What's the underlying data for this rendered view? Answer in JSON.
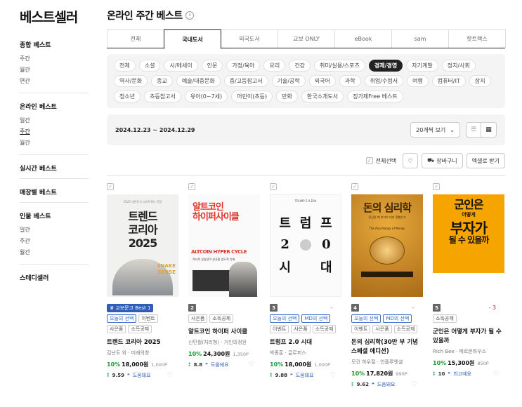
{
  "sidebar": {
    "title": "베스트셀러",
    "groups": [
      {
        "head": "종합 베스트",
        "items": [
          "주간",
          "월간",
          "연간"
        ]
      },
      {
        "head": "온라인 베스트",
        "items": [
          "일간",
          "주간",
          "월간"
        ]
      },
      {
        "head": "실시간 베스트",
        "items": []
      },
      {
        "head": "매장별 베스트",
        "items": []
      },
      {
        "head": "인물 베스트",
        "items": [
          "일간",
          "주간",
          "월간"
        ]
      },
      {
        "head": "스테디셀러",
        "items": []
      }
    ]
  },
  "main": {
    "title": "온라인 주간 베스트",
    "info": "!",
    "tabs": [
      "전체",
      "국내도서",
      "외국도서",
      "교보 ONLY",
      "eBook",
      "sam",
      "핫트랙스"
    ],
    "active_tab": "국내도서",
    "categories": [
      "전체",
      "소설",
      "시/에세이",
      "인문",
      "가정/육아",
      "요리",
      "건강",
      "취미/실용/스포츠",
      "경제/경영",
      "자기계발",
      "정치/사회",
      "역사/문화",
      "종교",
      "예술/대중문화",
      "중/고등참고서",
      "기술/공학",
      "외국어",
      "과학",
      "취업/수험서",
      "여행",
      "컴퓨터/IT",
      "잡지",
      "청소년",
      "초등참고서",
      "유아(0~7세)",
      "어린이(초등)",
      "만화",
      "한국소개도서",
      "징가제Free 베스트"
    ],
    "active_category": "경제/경영",
    "date_range": "2024.12.23 ~ 2024.12.29",
    "view_select": "20개씩 보기",
    "select_all": "전체선택",
    "cart": "장바구니",
    "excel": "엑셀로 받기"
  },
  "products": [
    {
      "rank": "",
      "badge": "교보문고 Best 1",
      "tags": [
        "오늘의 선택",
        "이벤트",
        "사은품",
        "소득공제"
      ],
      "tag_blue": [
        true,
        false,
        false,
        false
      ],
      "title": "트렌드 코리아 2025",
      "meta": "김난도 외 · 미래의창",
      "discount": "10%",
      "price": "18,000원",
      "points": "1,000P",
      "score": "9.59",
      "review": "도움돼요",
      "change": "",
      "cover": {
        "a": "2025 대한민국 소비트렌드 전망",
        "b": "트렌드\n코리아\n2025",
        "c": "SNAKE\nSENSE"
      }
    },
    {
      "rank": "2",
      "badge": "",
      "tags": [
        "사은품",
        "소득공제"
      ],
      "tag_blue": [
        false,
        false
      ],
      "title": "알트코인 하이퍼 사이클",
      "meta": "신민철(처리형) · 거인의정원",
      "discount": "10%",
      "price": "24,300원",
      "points": "1,350P",
      "score": "8.8",
      "review": "도움돼요",
      "change": "",
      "cover": {
        "a": "알트코인\n하이퍼사이클",
        "b": "ALTCOIN HYPER CYCLE",
        "c": "역사적 상승장이 선사할 압도적 기회"
      }
    },
    {
      "rank": "3",
      "badge": "",
      "tags": [
        "오늘의 선택",
        "MD의 선택",
        "이벤트",
        "사은품",
        "소득공제"
      ],
      "tag_blue": [
        true,
        true,
        false,
        false,
        false
      ],
      "title": "트럼프 2.0 시대",
      "meta": "박종훈 · 글로퍼스",
      "discount": "10%",
      "price": "18,000원",
      "points": "1,000P",
      "score": "9.88",
      "review": "도움돼요",
      "change": "–",
      "cover": {
        "a": "TRUMP 2.0 ERA",
        "g": [
          "트",
          "럼",
          "프",
          "2",
          "",
          "0",
          "시",
          "",
          "대"
        ]
      }
    },
    {
      "rank": "4",
      "badge": "",
      "tags": [
        "오늘의 선택",
        "MD의 선택",
        "이벤트",
        "사은품",
        "소득공제"
      ],
      "tag_blue": [
        true,
        true,
        false,
        false,
        false
      ],
      "title": "돈의 심리학(30만 부 기념 스페셜 에디션)",
      "meta": "모건 하우절 · 인플루엔셜",
      "discount": "10%",
      "price": "17,820원",
      "points": "990P",
      "score": "9.62",
      "review": "도움돼요",
      "change": "–",
      "cover": {
        "a": "돈의 심리학",
        "b": "당신은 왜 부자가 되지 못했는가",
        "c": "The Psychology of Money"
      }
    },
    {
      "rank": "5",
      "badge": "",
      "tags": [
        "소득공제"
      ],
      "tag_blue": [
        false
      ],
      "title": "군인은 어떻게 부자가 될 수 있을까",
      "meta": "Rich Bee · 메르몬하우스",
      "discount": "10%",
      "price": "15,300원",
      "points": "850P",
      "score": "10",
      "review": "최고예요",
      "change": "- 3",
      "cover": {
        "a": "군인은",
        "b": "어떻게",
        "c": "부자가",
        "d": "될 수 있을까"
      }
    }
  ],
  "colors": {
    "accent_green": "#1a9a38",
    "accent_blue": "#2f5fb5",
    "dark": "#222222"
  },
  "icons": [
    "info-icon",
    "chevron-down-icon",
    "list-view-icon",
    "grid-view-icon",
    "heart-icon",
    "cart-icon",
    "check-icon",
    "crown-icon",
    "quote-icon"
  ]
}
